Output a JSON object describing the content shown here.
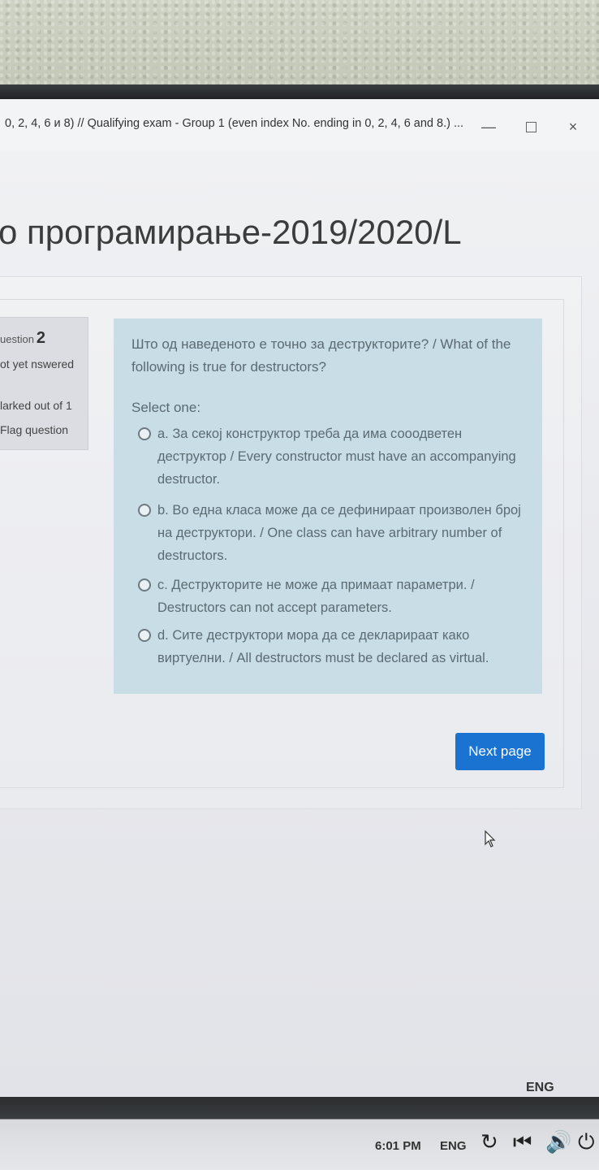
{
  "window": {
    "title": "0, 2, 4, 6 и 8) // Qualifying exam - Group 1 (even index No. ending in 0, 2, 4, 6 and 8.) ...",
    "minimize_label": "—",
    "close_label": "×"
  },
  "course": {
    "title": "о програмирање-2019/2020/L"
  },
  "question_info": {
    "question_label": "uestion",
    "question_number": "2",
    "state": "ot yet nswered",
    "marks": "larked out of 1",
    "flag": "Flag question"
  },
  "question": {
    "text": "Што од наведеното е точно за деструкторите? / What of the following is true for destructors?",
    "prompt": "Select one:",
    "answers": [
      {
        "label": "a. За секој конструктор треба да има сооодветен деструктор / Every constructor must have an accompanying destructor."
      },
      {
        "label": "b. Во една класа може да се дефинираат произволен број на деструктори. / One class can have arbitrary number of destructors."
      },
      {
        "label": "c. Деструкторите не може да примаат параметри. / Destructors can not accept parameters."
      },
      {
        "label": "d. Сите деструктори мора да се декларираат како виртуелни. / All destructors must be declared as virtual."
      }
    ]
  },
  "navigation": {
    "next_label": "Next page"
  },
  "tray": {
    "lang_indicator": "ENG"
  },
  "taskbar": {
    "time": "6:01 PM",
    "lang": "ENG",
    "icons": [
      "refresh-icon",
      "previous-track-icon",
      "volume-icon",
      "power-icon"
    ]
  },
  "colors": {
    "question_bg": "#c8dde6",
    "button": "#1a73d1"
  }
}
